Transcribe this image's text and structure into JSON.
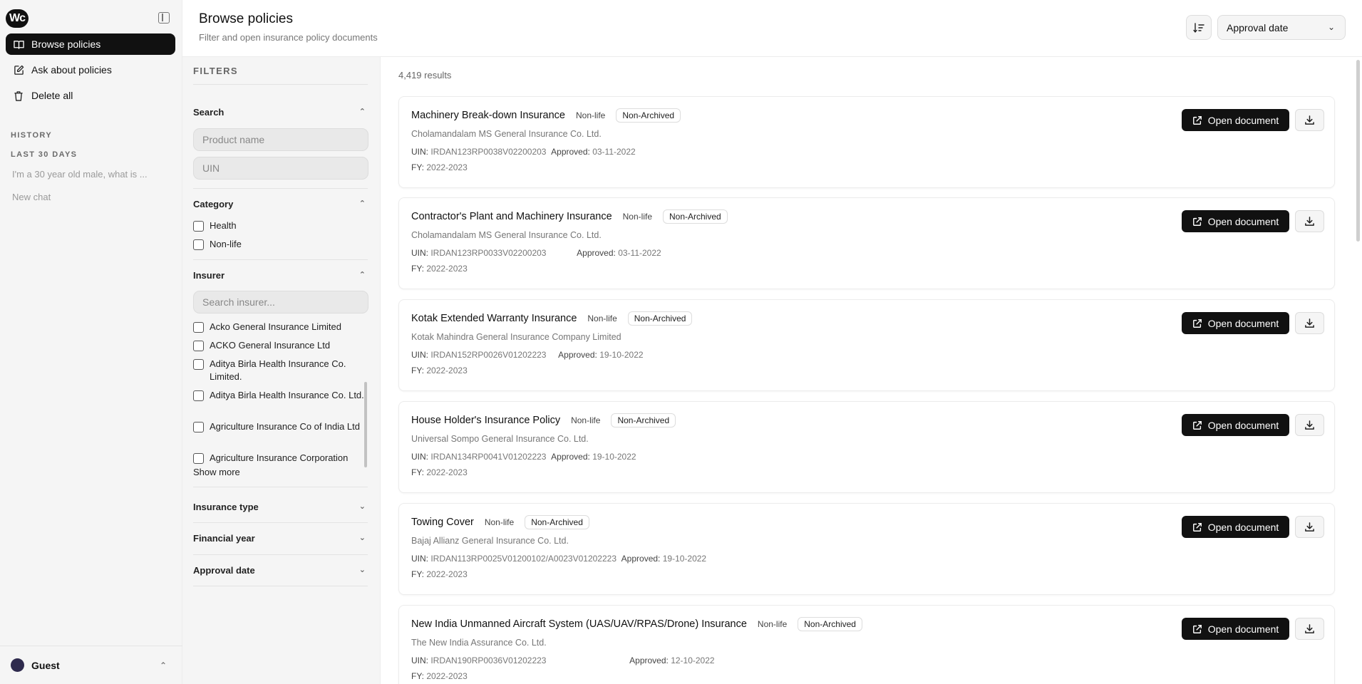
{
  "sidebar": {
    "logo_text": "Wc",
    "nav": [
      {
        "label": "Browse policies",
        "icon": "book-icon"
      },
      {
        "label": "Ask about policies",
        "icon": "edit-icon"
      },
      {
        "label": "Delete all",
        "icon": "trash-icon"
      }
    ],
    "history_label": "HISTORY",
    "period_label": "LAST 30 DAYS",
    "history_items": [
      "I'm a 30 year old male, what is ...",
      "New chat"
    ],
    "user_name": "Guest"
  },
  "header": {
    "title": "Browse policies",
    "subtitle": "Filter and open insurance policy documents",
    "sort_value": "Approval date"
  },
  "filters": {
    "title": "FILTERS",
    "search": {
      "label": "Search",
      "product_placeholder": "Product name",
      "uin_placeholder": "UIN"
    },
    "category": {
      "label": "Category",
      "options": [
        "Health",
        "Non-life"
      ]
    },
    "insurer": {
      "label": "Insurer",
      "search_placeholder": "Search insurer...",
      "options": [
        "Acko General Insurance Limited",
        "ACKO General Insurance Ltd",
        "Aditya Birla Health Insurance Co. Limited.",
        "Aditya Birla Health Insurance Co. Ltd.",
        "Agriculture Insurance Co of India Ltd",
        "Agriculture Insurance Corporation"
      ],
      "show_more": "Show more"
    },
    "insurance_type": "Insurance type",
    "financial_year": "Financial year",
    "approval_date": "Approval date"
  },
  "results": {
    "count": "4,419 results",
    "open_label": "Open document",
    "uin_prefix": "UIN:",
    "approved_prefix": "Approved:",
    "fy_prefix": "FY:",
    "items": [
      {
        "title": "Machinery Break-down Insurance",
        "category": "Non-life",
        "status": "Non-Archived",
        "insurer": "Cholamandalam MS General Insurance Co. Ltd.",
        "uin": "IRDAN123RP0038V02200203",
        "approved": "03-11-2022",
        "fy": "2022-2023"
      },
      {
        "title": "Contractor's Plant and Machinery Insurance",
        "category": "Non-life",
        "status": "Non-Archived",
        "insurer": "Cholamandalam MS General Insurance Co. Ltd.",
        "uin": "IRDAN123RP0033V02200203",
        "approved": "03-11-2022",
        "fy": "2022-2023"
      },
      {
        "title": "Kotak Extended Warranty Insurance",
        "category": "Non-life",
        "status": "Non-Archived",
        "insurer": "Kotak Mahindra General Insurance Company Limited",
        "uin": "IRDAN152RP0026V01202223",
        "approved": "19-10-2022",
        "fy": "2022-2023"
      },
      {
        "title": "House Holder's Insurance Policy",
        "category": "Non-life",
        "status": "Non-Archived",
        "insurer": "Universal Sompo General Insurance Co. Ltd.",
        "uin": "IRDAN134RP0041V01202223",
        "approved": "19-10-2022",
        "fy": "2022-2023"
      },
      {
        "title": "Towing Cover",
        "category": "Non-life",
        "status": "Non-Archived",
        "insurer": "Bajaj Allianz General Insurance Co. Ltd.",
        "uin": "IRDAN113RP0025V01200102/A0023V01202223",
        "approved": "19-10-2022",
        "fy": "2022-2023"
      },
      {
        "title": "New India Unmanned Aircraft System (UAS/UAV/RPAS/Drone) Insurance",
        "category": "Non-life",
        "status": "Non-Archived",
        "insurer": "The New India Assurance Co. Ltd.",
        "uin": "IRDAN190RP0036V01202223",
        "approved": "12-10-2022",
        "fy": "2022-2023"
      }
    ]
  }
}
